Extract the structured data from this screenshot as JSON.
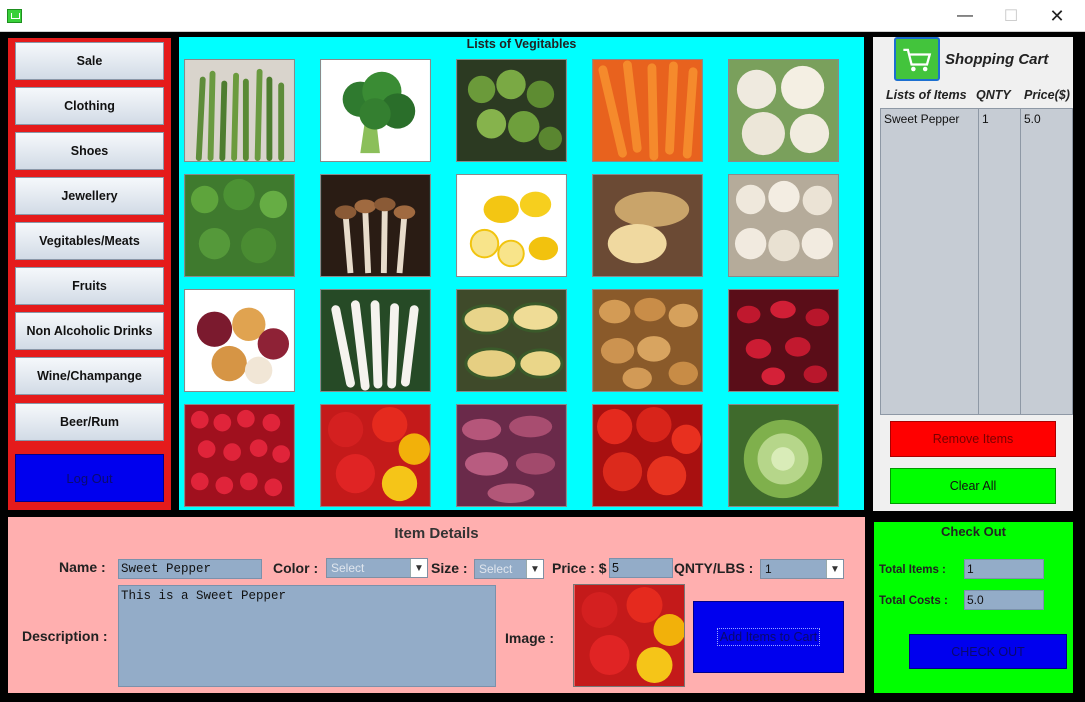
{
  "window": {
    "minimize_glyph": "—",
    "maximize_glyph": "☐",
    "close_glyph": "✕"
  },
  "menu": {
    "items": [
      "Sale",
      "Clothing",
      "Shoes",
      "Jewellery",
      "Vegitables/Meats",
      "Fruits",
      "Non Alcoholic Drinks",
      "Wine/Champange",
      "Beer/Rum"
    ],
    "logout": "Log Out"
  },
  "products": {
    "title": "Lists of Vegitables",
    "items": [
      "asparagus",
      "broccoli",
      "brussels-sprouts",
      "carrots",
      "cauliflower",
      "coriander",
      "mushrooms",
      "lemons",
      "ginger",
      "garlic",
      "onions",
      "radish-white",
      "squash",
      "potatoes",
      "red-chilli",
      "radishes",
      "sweet-pepper",
      "sweet-potatoes",
      "tomatoes",
      "cabbage"
    ]
  },
  "cart": {
    "title": "Shopping Cart",
    "col_items": "Lists of Items",
    "col_qnty": "QNTY",
    "col_price": "Price($)",
    "rows": [
      {
        "item": "Sweet Pepper",
        "qnty": "1",
        "price": "5.0"
      }
    ],
    "remove_label": "Remove Items",
    "clear_label": "Clear All"
  },
  "details": {
    "title": "Item Details",
    "name_label": "Name :",
    "name_value": "Sweet Pepper",
    "color_label": "Color :",
    "color_value": "Select",
    "size_label": "Size :",
    "size_value": "Select",
    "price_label": "Price : $",
    "price_value": "5",
    "qnty_label": "QNTY/LBS :",
    "qnty_value": "1",
    "description_label": "Description :",
    "description_value": "This is a Sweet Pepper",
    "image_label": "Image :",
    "add_label": "Add Items to Cart"
  },
  "checkout": {
    "title": "Check Out",
    "total_items_label": "Total Items :",
    "total_items_value": "1",
    "total_costs_label": "Total Costs :",
    "total_costs_value": "5.0",
    "button_label": "CHECK OUT"
  },
  "colors": {
    "menu_bg": "#e51b1b",
    "products_bg": "#00ffff",
    "details_bg": "#ffafaf",
    "checkout_bg": "#00ff00",
    "button_blue": "#0000ee",
    "remove_red": "#ff0000"
  }
}
